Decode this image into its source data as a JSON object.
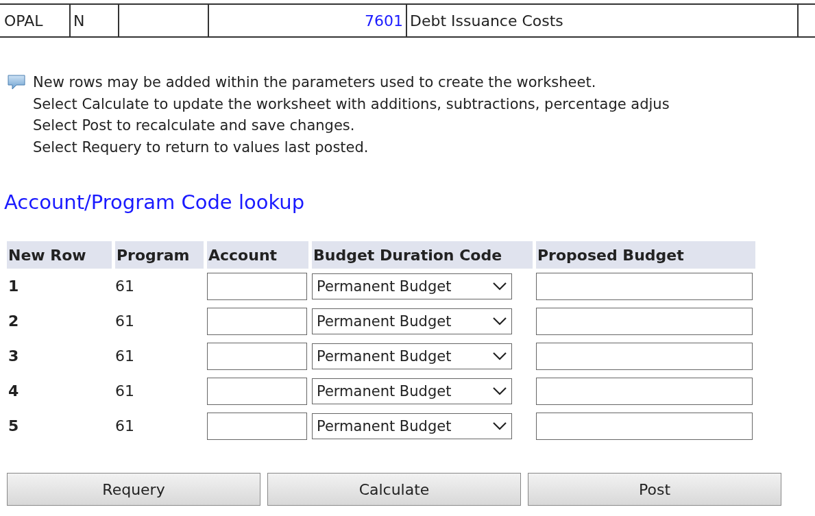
{
  "account_row": {
    "cells": [
      {
        "kind": "text",
        "text": "OPAL"
      },
      {
        "kind": "text",
        "text": "N"
      },
      {
        "kind": "empty"
      },
      {
        "kind": "link",
        "text": "7601"
      },
      {
        "kind": "text",
        "text": "Debt Issuance Costs"
      },
      {
        "kind": "empty"
      }
    ]
  },
  "notes": [
    "New rows may be added within the parameters used to create the worksheet.",
    "Select Calculate to update the worksheet with additions, subtractions, percentage adjus",
    "Select Post to recalculate and save changes.",
    "Select Requery to return to values last posted."
  ],
  "lookup_title": "Account/Program Code lookup",
  "new_rows": {
    "columns": [
      "New Row",
      "Program",
      "Account",
      "Budget Duration Code",
      "Proposed Budget"
    ],
    "rows": [
      {
        "row": "1",
        "program": "61",
        "duration": "Permanent Budget"
      },
      {
        "row": "2",
        "program": "61",
        "duration": "Permanent Budget"
      },
      {
        "row": "3",
        "program": "61",
        "duration": "Permanent Budget"
      },
      {
        "row": "4",
        "program": "61",
        "duration": "Permanent Budget"
      },
      {
        "row": "5",
        "program": "61",
        "duration": "Permanent Budget"
      }
    ]
  },
  "buttons": [
    "Requery",
    "Calculate",
    "Post"
  ]
}
